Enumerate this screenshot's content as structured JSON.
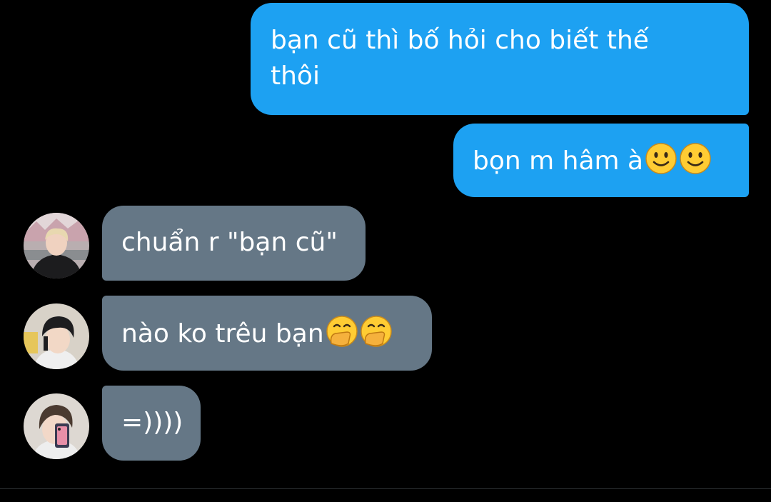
{
  "colors": {
    "background": "#000000",
    "outgoing_bubble": "#1da1f2",
    "incoming_bubble": "#657786",
    "text": "#ffffff"
  },
  "messages": [
    {
      "direction": "outgoing",
      "lines": [
        "bạn cũ thì bố hỏi cho biết thế",
        "thôi"
      ]
    },
    {
      "direction": "outgoing",
      "text": "bọn m hâm à",
      "emoji": [
        "slightly-smiling-face-icon",
        "slightly-smiling-face-icon"
      ]
    },
    {
      "direction": "incoming",
      "text": "chuẩn r \"bạn cũ\"",
      "avatar": "avatar-1"
    },
    {
      "direction": "incoming",
      "text": "nào ko trêu bạn",
      "emoji": [
        "face-with-hand-over-mouth-icon",
        "face-with-hand-over-mouth-icon"
      ],
      "avatar": "avatar-2"
    },
    {
      "direction": "incoming",
      "text": "=))))",
      "avatar": "avatar-3"
    }
  ]
}
